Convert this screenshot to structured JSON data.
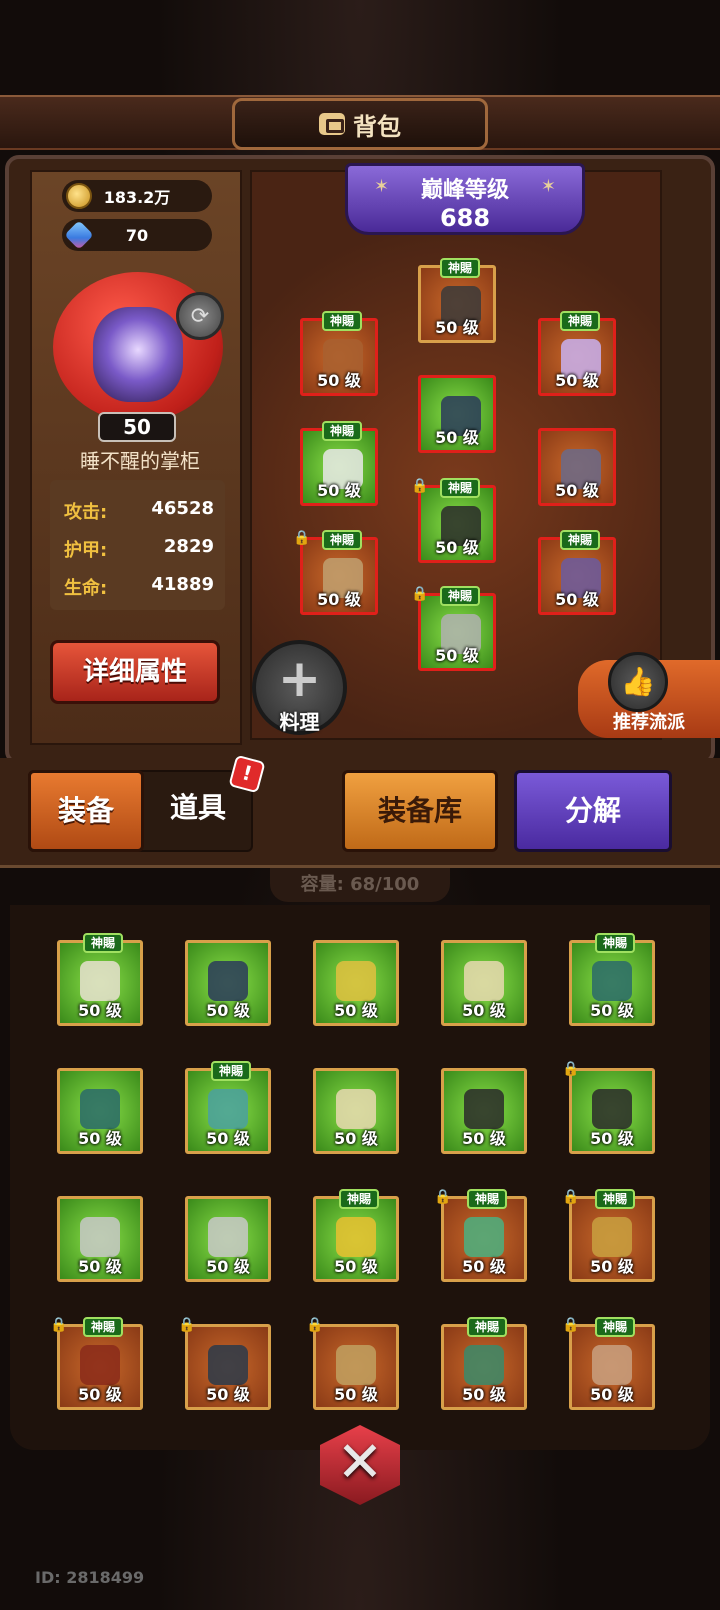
{
  "header": {
    "title": "背包",
    "bag_icon": "bag-icon"
  },
  "resources": {
    "coins": "183.2万",
    "gems": "70"
  },
  "hero": {
    "level": "50",
    "name": "睡不醒的掌柜",
    "stats": [
      {
        "key": "攻击:",
        "value": "46528"
      },
      {
        "key": "护甲:",
        "value": "2829"
      },
      {
        "key": "生命:",
        "value": "41889"
      }
    ],
    "detail_button": "详细属性"
  },
  "pinnacle": {
    "title": "巅峰等级",
    "value": "688"
  },
  "equipped": [
    {
      "tag": "神賜",
      "level": "50 级",
      "bg": "orange",
      "color": "#3a3a3a",
      "lock": false,
      "red": false
    },
    {
      "tag": "神賜",
      "level": "50 级",
      "bg": "orange",
      "color": "#a86030",
      "lock": false,
      "red": true
    },
    {
      "tag": "神賜",
      "level": "50 级",
      "bg": "orange",
      "color": "#c8b0f0",
      "lock": false,
      "red": true
    },
    {
      "tag": "",
      "level": "50 级",
      "bg": "green",
      "color": "#2a3a5a",
      "lock": false,
      "red": true
    },
    {
      "tag": "神賜",
      "level": "50 级",
      "bg": "green",
      "color": "#e8e8e8",
      "lock": false,
      "red": true
    },
    {
      "tag": "",
      "level": "50 级",
      "bg": "orange",
      "color": "#6a6a8a",
      "lock": false,
      "red": true
    },
    {
      "tag": "神賜",
      "level": "50 级",
      "bg": "green",
      "color": "#2a2a2a",
      "lock": true,
      "red": true
    },
    {
      "tag": "神賜",
      "level": "50 级",
      "bg": "orange",
      "color": "#c0a070",
      "lock": true,
      "red": true
    },
    {
      "tag": "神賜",
      "level": "50 级",
      "bg": "orange",
      "color": "#6a5aa0",
      "lock": false,
      "red": true
    },
    {
      "tag": "神賜",
      "level": "50 级",
      "bg": "green",
      "color": "#b0b0b0",
      "lock": true,
      "red": true
    }
  ],
  "buttons": {
    "cook": "料理",
    "recommend": "推荐流派",
    "tab_equipment": "装备",
    "tab_items": "道具",
    "alert": "!",
    "equipment_library": "装备库",
    "decompose": "分解"
  },
  "capacity": "容量: 68/100",
  "inventory": [
    {
      "tag": "神賜",
      "level": "50 级",
      "bg": "green",
      "color": "#e8e0d0",
      "lock": false
    },
    {
      "tag": "",
      "level": "50 级",
      "bg": "green",
      "color": "#2a3a5a",
      "lock": false
    },
    {
      "tag": "",
      "level": "50 级",
      "bg": "green",
      "color": "#e0c040",
      "lock": false
    },
    {
      "tag": "",
      "level": "50 级",
      "bg": "green",
      "color": "#e8d8b0",
      "lock": false
    },
    {
      "tag": "神賜",
      "level": "50 级",
      "bg": "green",
      "color": "#2a6a6a",
      "lock": false
    },
    {
      "tag": "",
      "level": "50 级",
      "bg": "green",
      "color": "#2a6a6a",
      "lock": false
    },
    {
      "tag": "神賜",
      "level": "50 级",
      "bg": "green",
      "color": "#4aa0a0",
      "lock": false
    },
    {
      "tag": "",
      "level": "50 级",
      "bg": "green",
      "color": "#e8d8b0",
      "lock": false
    },
    {
      "tag": "",
      "level": "50 级",
      "bg": "green",
      "color": "#2a2a2a",
      "lock": false
    },
    {
      "tag": "",
      "level": "50 级",
      "bg": "green",
      "color": "#2a2a2a",
      "lock": true
    },
    {
      "tag": "",
      "level": "50 级",
      "bg": "green",
      "color": "#c8c8c8",
      "lock": false
    },
    {
      "tag": "",
      "level": "50 级",
      "bg": "green",
      "color": "#c8c8c8",
      "lock": false
    },
    {
      "tag": "神賜",
      "level": "50 级",
      "bg": "green",
      "color": "#e8c030",
      "lock": false
    },
    {
      "tag": "神賜",
      "level": "50 级",
      "bg": "orange",
      "color": "#4ab080",
      "lock": true
    },
    {
      "tag": "神賜",
      "level": "50 级",
      "bg": "orange",
      "color": "#c8a040",
      "lock": true
    },
    {
      "tag": "神賜",
      "level": "50 级",
      "bg": "orange",
      "color": "#8a2a1a",
      "lock": true
    },
    {
      "tag": "",
      "level": "50 级",
      "bg": "orange",
      "color": "#2a3a4a",
      "lock": true
    },
    {
      "tag": "",
      "level": "50 级",
      "bg": "orange",
      "color": "#c0a060",
      "lock": true
    },
    {
      "tag": "神賜",
      "level": "50 级",
      "bg": "orange",
      "color": "#3a8a6a",
      "lock": false
    },
    {
      "tag": "神賜",
      "level": "50 级",
      "bg": "orange",
      "color": "#c8a080",
      "lock": true
    }
  ],
  "fab": {
    "icon": "crossed-swords-icon"
  },
  "user_id": "ID: 2818499"
}
